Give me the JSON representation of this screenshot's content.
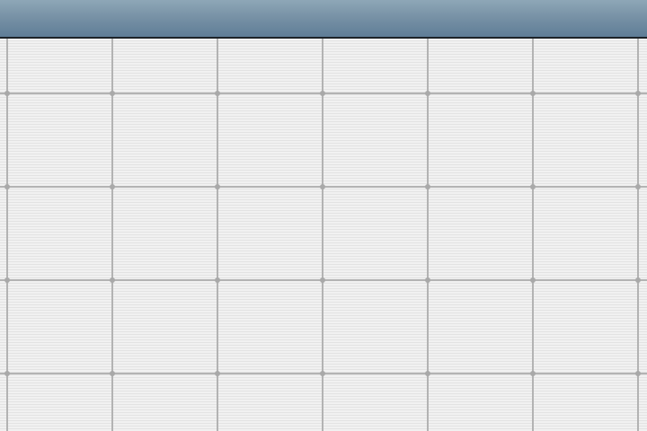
{
  "title_bar": {
    "title": ""
  },
  "grid": {
    "line_color": "#b3b3b3",
    "node_color": "#a9a9a9",
    "columns": 6,
    "rows": 4
  }
}
